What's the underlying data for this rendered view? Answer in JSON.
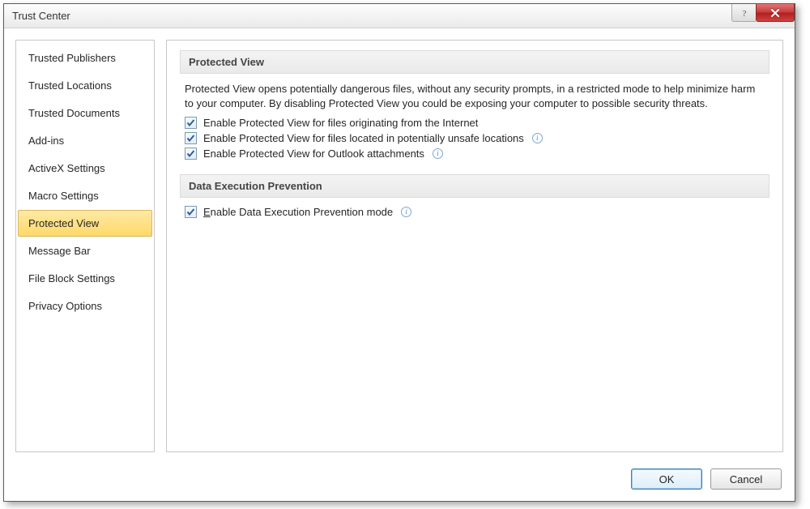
{
  "window": {
    "title": "Trust Center"
  },
  "sidebar": {
    "items": [
      {
        "label": "Trusted Publishers"
      },
      {
        "label": "Trusted Locations"
      },
      {
        "label": "Trusted Documents"
      },
      {
        "label": "Add-ins"
      },
      {
        "label": "ActiveX Settings"
      },
      {
        "label": "Macro Settings"
      },
      {
        "label": "Protected View"
      },
      {
        "label": "Message Bar"
      },
      {
        "label": "File Block Settings"
      },
      {
        "label": "Privacy Options"
      }
    ],
    "selected_index": 6
  },
  "main": {
    "sections": [
      {
        "title": "Protected View",
        "description": "Protected View opens potentially dangerous files, without any security prompts, in a restricted mode to help minimize harm to your computer. By disabling Protected View you could be exposing your computer to possible security threats.",
        "options": [
          {
            "label": "Enable Protected View for files originating from the Internet",
            "checked": true,
            "info": false
          },
          {
            "label": "Enable Protected View for files located in potentially unsafe locations",
            "checked": true,
            "info": true
          },
          {
            "label": "Enable Protected View for Outlook attachments",
            "checked": true,
            "info": true
          }
        ]
      },
      {
        "title": "Data Execution Prevention",
        "options": [
          {
            "label": "Enable Data Execution Prevention mode",
            "checked": true,
            "info": true
          }
        ]
      }
    ]
  },
  "footer": {
    "ok": "OK",
    "cancel": "Cancel"
  }
}
